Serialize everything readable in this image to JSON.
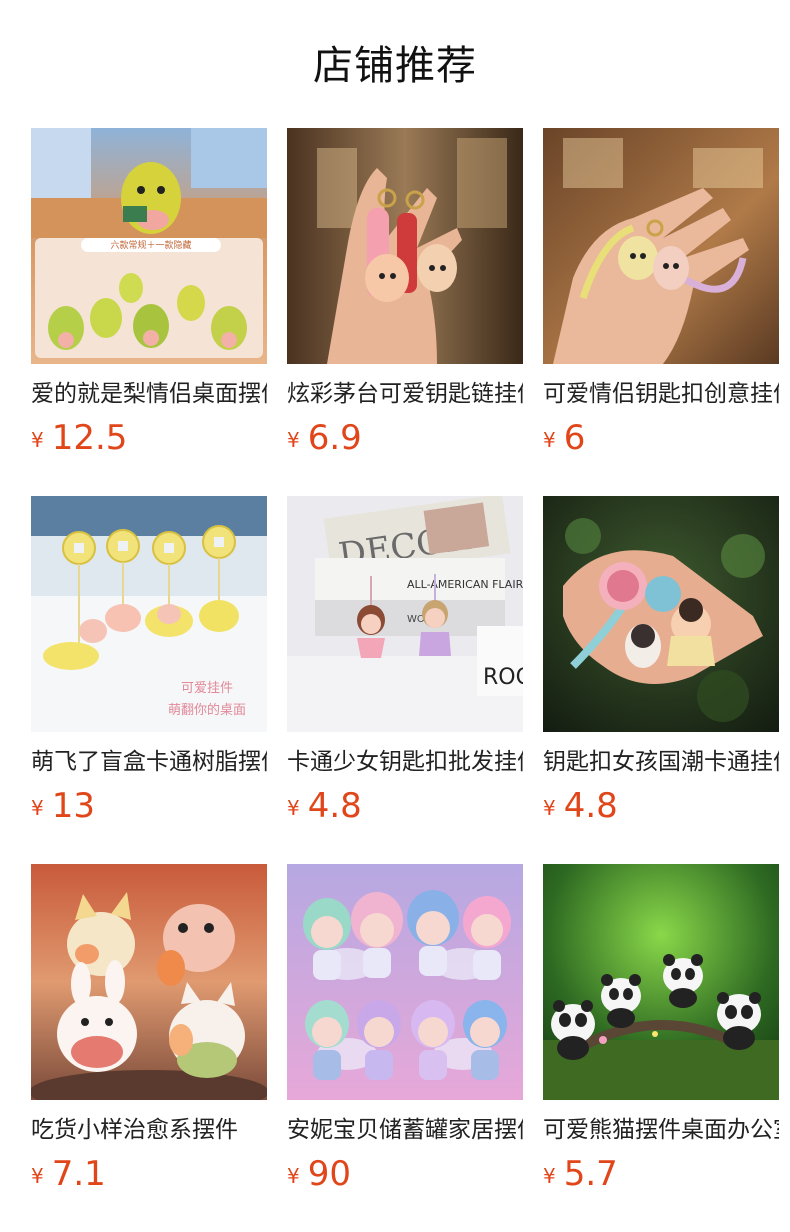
{
  "section": {
    "title": "店铺推荐"
  },
  "currency_symbol": "¥",
  "products": [
    {
      "name": "爱的就是梨情侣桌面摆件",
      "price": "12.5",
      "thumb_text": [
        "六款常规＋一款隐藏"
      ]
    },
    {
      "name": "炫彩茅台可爱钥匙链挂件",
      "price": "6.9"
    },
    {
      "name": "可爱情侣钥匙扣创意挂件",
      "price": "6"
    },
    {
      "name": "萌飞了盲盒卡通树脂摆件",
      "price": "13",
      "thumb_text": [
        "可爱挂件",
        "萌翻你的桌面"
      ]
    },
    {
      "name": "卡通少女钥匙扣批发挂件",
      "price": "4.8",
      "thumb_text": [
        "DECOR",
        "ALL-AMERICAN FLAIR",
        "WORLD",
        "ROC"
      ]
    },
    {
      "name": "钥匙扣女孩国潮卡通挂件",
      "price": "4.8"
    },
    {
      "name": "吃货小样治愈系摆件",
      "price": "7.1"
    },
    {
      "name": "安妮宝贝储蓄罐家居摆件",
      "price": "90"
    },
    {
      "name": "可爱熊猫摆件桌面办公室",
      "price": "5.7"
    }
  ],
  "colors": {
    "price": "#e0461a",
    "title": "#111111",
    "name": "#222222"
  }
}
